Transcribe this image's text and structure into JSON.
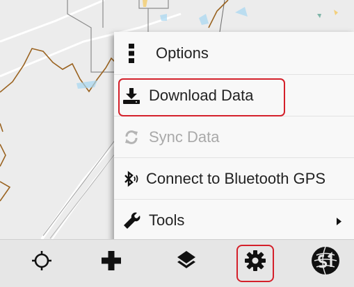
{
  "menu": {
    "items": [
      {
        "label": "Options",
        "icon": "vertical-dots-icon",
        "enabled": true
      },
      {
        "label": "Download Data",
        "icon": "download-icon",
        "enabled": true,
        "highlighted": true
      },
      {
        "label": "Sync Data",
        "icon": "sync-icon",
        "enabled": false
      },
      {
        "label": "Connect to Bluetooth GPS",
        "icon": "bluetooth-icon",
        "enabled": true
      },
      {
        "label": "Tools",
        "icon": "wrench-icon",
        "enabled": true,
        "has_submenu": true
      }
    ]
  },
  "toolbar": {
    "buttons": [
      {
        "icon": "crosshair-icon"
      },
      {
        "icon": "plus-icon"
      },
      {
        "icon": "layers-icon"
      },
      {
        "icon": "gear-icon",
        "highlighted": true
      },
      {
        "icon": "s1-logo-icon"
      }
    ]
  },
  "colors": {
    "highlight": "#d4202a",
    "map_background": "#ececec",
    "trail": "#9a6320",
    "water": "#a6d7f2"
  }
}
